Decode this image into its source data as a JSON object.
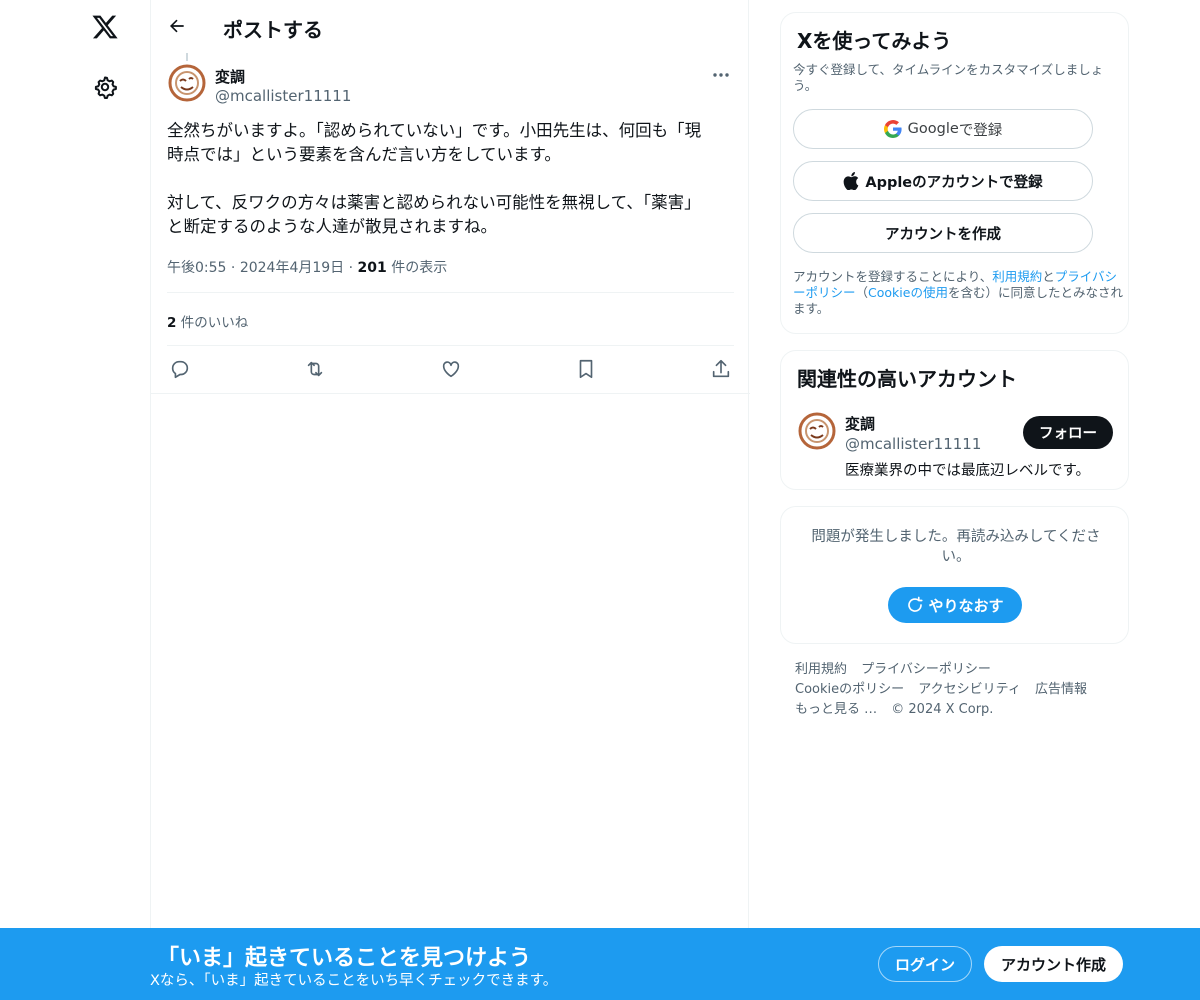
{
  "nav": {
    "logo_icon": "x-logo-icon",
    "settings_icon": "gear-icon"
  },
  "header": {
    "title": "ポストする"
  },
  "post": {
    "author_name": "変調",
    "author_handle": "@mcallister11111",
    "text": "全然ちがいますよ。「認められていない」です。小田先生は、何回も「現\n時点では」という要素を含んだ言い方をしています。\n\n対して、反ワクの方々は薬害と認められない可能性を無視して、「薬害」\nと断定するのような人達が散見されますね。",
    "time": "午後0:55",
    "date": "2024年4月19日",
    "views_count": "201",
    "views_label": "件の表示",
    "likes_count": "2",
    "likes_label": "件のいいね"
  },
  "signup_card": {
    "title": "Xを使ってみよう",
    "subtitle": "今すぐ登録して、タイムラインをカスタマイズしましょう。",
    "google_label_bold": "Google",
    "google_label": " で登録",
    "apple_label": "Appleのアカウントで登録",
    "create_label": "アカウントを作成",
    "terms_prefix": "アカウントを登録することにより、",
    "terms_link1": "利用規約",
    "terms_and": "と",
    "terms_link2": "プライバシーポリシー",
    "terms_paren_open": "（",
    "terms_link3": "Cookieの使用",
    "terms_suffix": "を含む）に同意したとみなされます。"
  },
  "recommend": {
    "title": "関連性の高いアカウント",
    "name": "変調",
    "handle": "@mcallister11111",
    "bio": "医療業界の中では最底辺レベルです。",
    "follow_label": "フォロー"
  },
  "error_card": {
    "message": "問題が発生しました。再読み込みしてください。",
    "retry_label": "やりなおす"
  },
  "footer": {
    "line1": [
      "利用規約",
      "プライバシーポリシー"
    ],
    "line2": [
      "Cookieのポリシー",
      "アクセシビリティ",
      "広告情報"
    ],
    "more": "もっと見る …",
    "copyright": "© 2024 X Corp."
  },
  "banner": {
    "title": "「いま」起きていることを見つけよう",
    "subtitle": "Xなら、「いま」起きていることをいち早くチェックできます。",
    "login_label": "ログイン",
    "signup_label": "アカウント作成"
  },
  "colors": {
    "accent": "#1d9bf0",
    "text": "#0f1419",
    "muted": "#536471",
    "border": "#eff3f4"
  }
}
